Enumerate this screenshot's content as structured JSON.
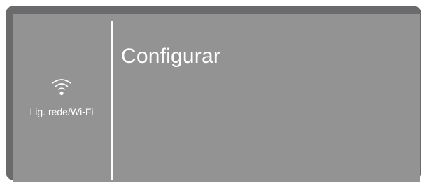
{
  "sidebar": {
    "wifi_label": "Lig. rede/Wi-Fi",
    "wifi_icon": "wifi-icon"
  },
  "main": {
    "title": "Configurar"
  },
  "colors": {
    "frame": "#6b6b6d",
    "screen": "#939394",
    "text": "#ffffff",
    "divider": "#ffffff"
  }
}
